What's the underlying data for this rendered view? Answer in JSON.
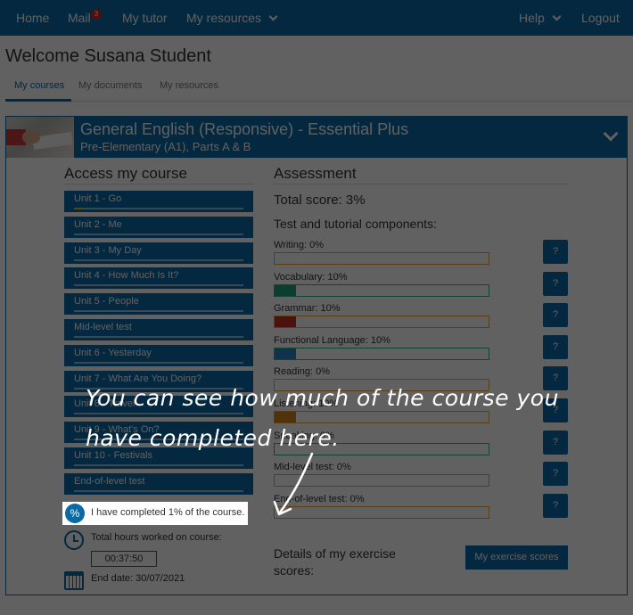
{
  "nav": {
    "home": "Home",
    "mail": "Mail",
    "mail_badge": "3",
    "tutor": "My tutor",
    "resources": "My resources",
    "help": "Help",
    "logout": "Logout"
  },
  "welcome": "Welcome Susana Student",
  "tabs": [
    "My courses",
    "My documents",
    "My resources"
  ],
  "course": {
    "title": "General English (Responsive) - Essential Plus",
    "subtitle": "Pre-Elementary (A1), Parts A & B"
  },
  "access": {
    "title": "Access my course",
    "units": [
      {
        "label": "Unit 1 - Go",
        "progress": 0.05
      },
      {
        "label": "Unit 2 - Me",
        "progress": 0
      },
      {
        "label": "Unit 3 - My Day",
        "progress": 0
      },
      {
        "label": "Unit 4 - How Much Is It?",
        "progress": 0
      },
      {
        "label": "Unit 5 - People",
        "progress": 0
      },
      {
        "label": "Mid-level test",
        "progress": 0
      },
      {
        "label": "Unit 6 - Yesterday",
        "progress": 0
      },
      {
        "label": "Unit 7 - What Are You Doing?",
        "progress": 0
      },
      {
        "label": "Unit 8 - Travel",
        "progress": 0
      },
      {
        "label": "Unit 9 - What's On?",
        "progress": 0
      },
      {
        "label": "Unit 10 - Festivals",
        "progress": 0
      },
      {
        "label": "End-of-level test",
        "progress": 0
      }
    ],
    "completed_text": "I have completed 1% of the course.",
    "hours_label": "Total hours worked on course:",
    "hours_value": "00:37:50",
    "end_date": "End date: 30/07/2021"
  },
  "assessment": {
    "title": "Assessment",
    "total_score": "Total score: 3%",
    "components_label": "Test and tutorial components:",
    "components": [
      {
        "label": "Writing: 0%",
        "value": 0,
        "color": "#e4a23a",
        "border": "#e4a23a"
      },
      {
        "label": "Vocabulary: 10%",
        "value": 10,
        "color": "#1fa27a",
        "border": "#2db287"
      },
      {
        "label": "Grammar: 10%",
        "value": 10,
        "color": "#c9302c",
        "border": "#e4a23a"
      },
      {
        "label": "Functional Language: 10%",
        "value": 10,
        "color": "#2e86c1",
        "border": "#2db287"
      },
      {
        "label": "Reading: 0%",
        "value": 0,
        "color": "#e4a23a",
        "border": "#e4a23a"
      },
      {
        "label": "Listening: 10%",
        "value": 10,
        "color": "#d4831e",
        "border": "#e4a23a"
      },
      {
        "label": "Speaking: 0%",
        "value": 0,
        "color": "#2db287",
        "border": "#2db287"
      },
      {
        "label": "Mid-level test: 0%",
        "value": 0,
        "color": "#aaaaaa",
        "border": "#aaaaaa"
      },
      {
        "label": "End-of-level test: 0%",
        "value": 0,
        "color": "#e4a23a",
        "border": "#e4a23a"
      }
    ],
    "help_label": "?",
    "details_line1": "Details of my exercise",
    "details_line2": "scores:",
    "exercise_button": "My exercise scores"
  },
  "callout": {
    "line1": "You can see how much of the course you",
    "line2": "have completed here."
  },
  "icons": {
    "percent": "%"
  }
}
